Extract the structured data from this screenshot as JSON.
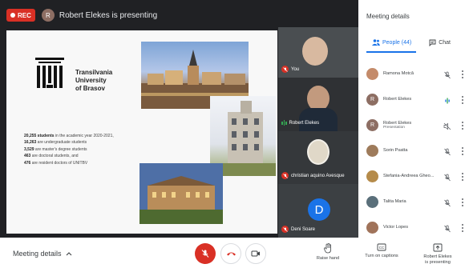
{
  "topbar": {
    "rec_label": "REC",
    "presenter_initial": "R",
    "presenting_text": "Robert Elekes is presenting"
  },
  "slide": {
    "university": [
      "Transilvania",
      "University",
      "of Brasov"
    ],
    "stats": [
      {
        "num": "20,255 students",
        "text": " in the academic year 2020-2021,"
      },
      {
        "num": "16,263",
        "text": " are undergraduate students"
      },
      {
        "num": "3,529",
        "text": " are master's degree students"
      },
      {
        "num": "463",
        "text": " are doctoral students, and"
      },
      {
        "num": "476",
        "text": " are resident doctors of UNITBV"
      }
    ]
  },
  "tiles": [
    {
      "name": "You",
      "muted": true
    },
    {
      "name": "Robert Elekes",
      "muted": false
    },
    {
      "name": "christian aquino Avesque",
      "muted": true
    },
    {
      "name": "Deni Soare",
      "muted": true,
      "initial": "D"
    }
  ],
  "panel": {
    "title": "Meeting details",
    "tab_people": "People (44)",
    "tab_chat": "Chat",
    "participants": [
      {
        "name": "Ramona Motcă",
        "sub": "",
        "initial": "",
        "color": "#c48b6a",
        "mic": "off"
      },
      {
        "name": "Robert Elekes",
        "sub": "",
        "initial": "R",
        "color": "#8d6e63",
        "mic": "speaking"
      },
      {
        "name": "Robert Elekes",
        "sub": "Presentation",
        "initial": "R",
        "color": "#8d6e63",
        "mic": "muted-speaker"
      },
      {
        "name": "Sorin Psatta",
        "sub": "",
        "initial": "",
        "color": "#9e7b5b",
        "mic": "off"
      },
      {
        "name": "Stefania-Andreea Gheo...",
        "sub": "",
        "initial": "",
        "color": "#b58b4a",
        "mic": "off"
      },
      {
        "name": "Talita Maria",
        "sub": "",
        "initial": "",
        "color": "#5a6f7a",
        "mic": "off"
      },
      {
        "name": "Victor Lopes",
        "sub": "",
        "initial": "",
        "color": "#a0735a",
        "mic": "off"
      }
    ]
  },
  "bottombar": {
    "meeting_details": "Meeting details",
    "raise_hand": "Raise hand",
    "captions": "Turn on captions",
    "presenting": [
      "Robert Elekes",
      "is presenting"
    ]
  },
  "colors": {
    "accent": "#1a73e8",
    "danger": "#d93025",
    "stage": "#202124"
  }
}
